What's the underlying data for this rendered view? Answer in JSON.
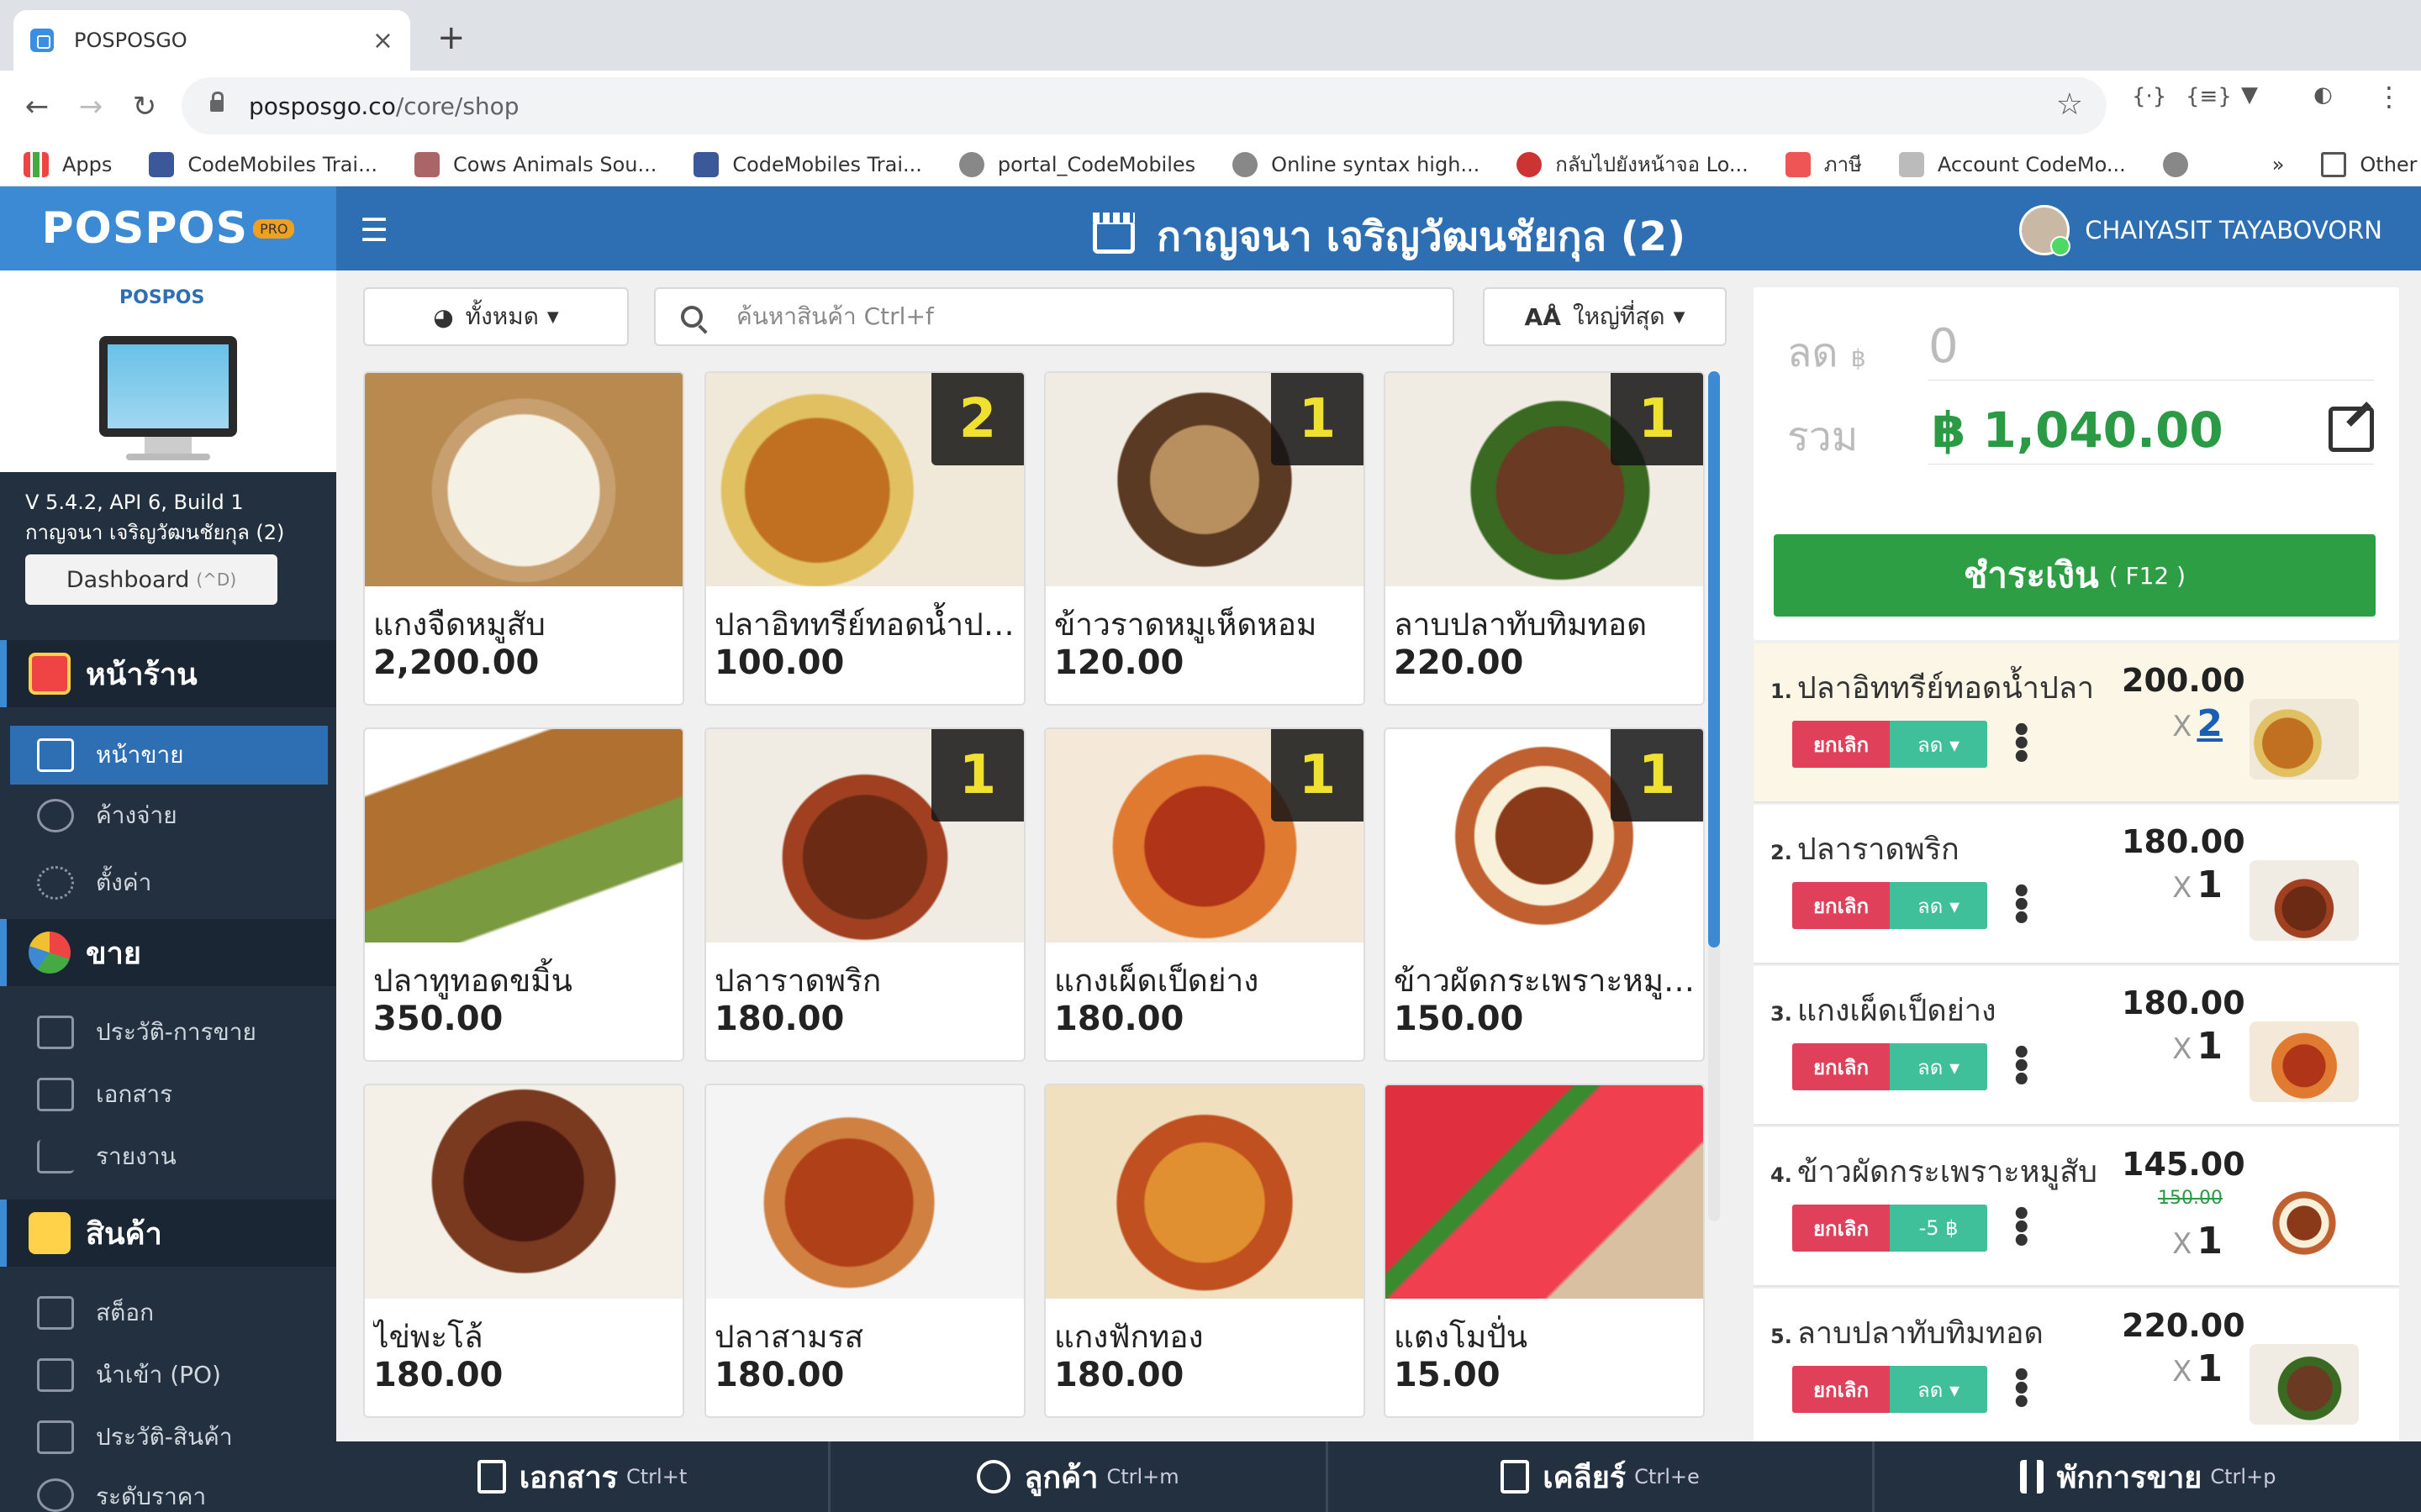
{
  "browser": {
    "tab_title": "POSPOSGO",
    "tab_close": "×",
    "new_tab": "+",
    "url_host": "posposgo.co",
    "url_path": "/core/shop",
    "bookmarks": [
      "Apps",
      "CodeMobiles Trai...",
      "Cows Animals Sou...",
      "CodeMobiles Trai...",
      "portal_CodeMobiles",
      "Online syntax high...",
      "กลับไปยังหน้าจอ Lo...",
      "ภาษี",
      "Account CodeMo..."
    ],
    "overflow": "»",
    "other_bookmarks": "Other Bookmarks"
  },
  "header": {
    "logo": "POSPOS",
    "logo_badge": "PRO",
    "shop": "กาญจนา เจริญวัฒนชัยกุล (2)",
    "user": "CHAIYASIT TAYABOVORN"
  },
  "sidebar": {
    "brand": "POSPOS",
    "version": "V 5.4.2, API 6, Build 1",
    "shop": "กาญจนา เจริญวัฒนชัยกุล (2)",
    "dashboard": "Dashboard",
    "dashboard_key": "(^D)",
    "sections": [
      {
        "title": "หน้าร้าน",
        "items": [
          "หน้าขาย",
          "ค้างจ่าย",
          "ตั้งค่า"
        ]
      },
      {
        "title": "ขาย",
        "items": [
          "ประวัติ-การขาย",
          "เอกสาร",
          "รายงาน"
        ]
      },
      {
        "title": "สินค้า",
        "items": [
          "สต็อก",
          "นำเข้า (PO)",
          "ประวัติ-สินค้า",
          "ระดับราคา"
        ]
      }
    ]
  },
  "toolbar": {
    "filter": "ทั้งหมด",
    "search_placeholder": "ค้นหาสินค้า Ctrl+f",
    "size": "ใหญ่ที่สุด"
  },
  "products": [
    {
      "name": "แกงจืดหมูสับ",
      "price": "2,200.00",
      "qty": ""
    },
    {
      "name": "ปลาอิททรีย์ทอดน้ำปลา",
      "price": "100.00",
      "qty": "2"
    },
    {
      "name": "ข้าวราดหมูเห็ดหอม",
      "price": "120.00",
      "qty": "1"
    },
    {
      "name": "ลาบปลาทับทิมทอด",
      "price": "220.00",
      "qty": "1"
    },
    {
      "name": "ปลาทูทอดขมิ้น",
      "price": "350.00",
      "qty": ""
    },
    {
      "name": "ปลาราดพริก",
      "price": "180.00",
      "qty": "1"
    },
    {
      "name": "แกงเผ็ดเป็ดย่าง",
      "price": "180.00",
      "qty": "1"
    },
    {
      "name": "ข้าวผัดกระเพราะหมูสับ",
      "price": "150.00",
      "qty": "1"
    },
    {
      "name": "ไข่พะโล้",
      "price": "180.00",
      "qty": ""
    },
    {
      "name": "ปลาสามรส",
      "price": "180.00",
      "qty": ""
    },
    {
      "name": "แกงฟักทอง",
      "price": "180.00",
      "qty": ""
    },
    {
      "name": "แตงโมปั่น",
      "price": "15.00",
      "qty": ""
    }
  ],
  "cart": {
    "discount_label": "ลด",
    "discount_currency": "฿",
    "discount_value": "0",
    "total_label": "รวม",
    "total": "฿ 1,040.00",
    "pay": "ชำระเงิน",
    "pay_key": "( F12 )",
    "items": [
      {
        "no": "1.",
        "name": "ปลาอิททรีย์ทอดน้ำปลา",
        "price": "200.00",
        "old": "",
        "qty": "2",
        "cancel": "ยกเลิก",
        "disc": "ลด ▾"
      },
      {
        "no": "2.",
        "name": "ปลาราดพริก",
        "price": "180.00",
        "old": "",
        "qty": "1",
        "cancel": "ยกเลิก",
        "disc": "ลด ▾"
      },
      {
        "no": "3.",
        "name": "แกงเผ็ดเป็ดย่าง",
        "price": "180.00",
        "old": "",
        "qty": "1",
        "cancel": "ยกเลิก",
        "disc": "ลด ▾"
      },
      {
        "no": "4.",
        "name": "ข้าวผัดกระเพราะหมูสับ",
        "price": "145.00",
        "old": "150.00",
        "qty": "1",
        "cancel": "ยกเลิก",
        "disc": "-5 ฿"
      },
      {
        "no": "5.",
        "name": "ลาบปลาทับทิมทอด",
        "price": "220.00",
        "old": "",
        "qty": "1",
        "cancel": "ยกเลิก",
        "disc": "ลด ▾"
      }
    ]
  },
  "bottom": [
    {
      "label": "เอกสาร",
      "key": "Ctrl+t"
    },
    {
      "label": "ลูกค้า",
      "key": "Ctrl+m"
    },
    {
      "label": "เคลียร์",
      "key": "Ctrl+e"
    },
    {
      "label": "พักการขาย",
      "key": "Ctrl+p"
    }
  ],
  "colors": {
    "primary": "#2e6fb4",
    "sidebar": "#22303f",
    "pay": "#2e9e45",
    "cancel": "#e0405a",
    "discount": "#3fbf9a"
  }
}
